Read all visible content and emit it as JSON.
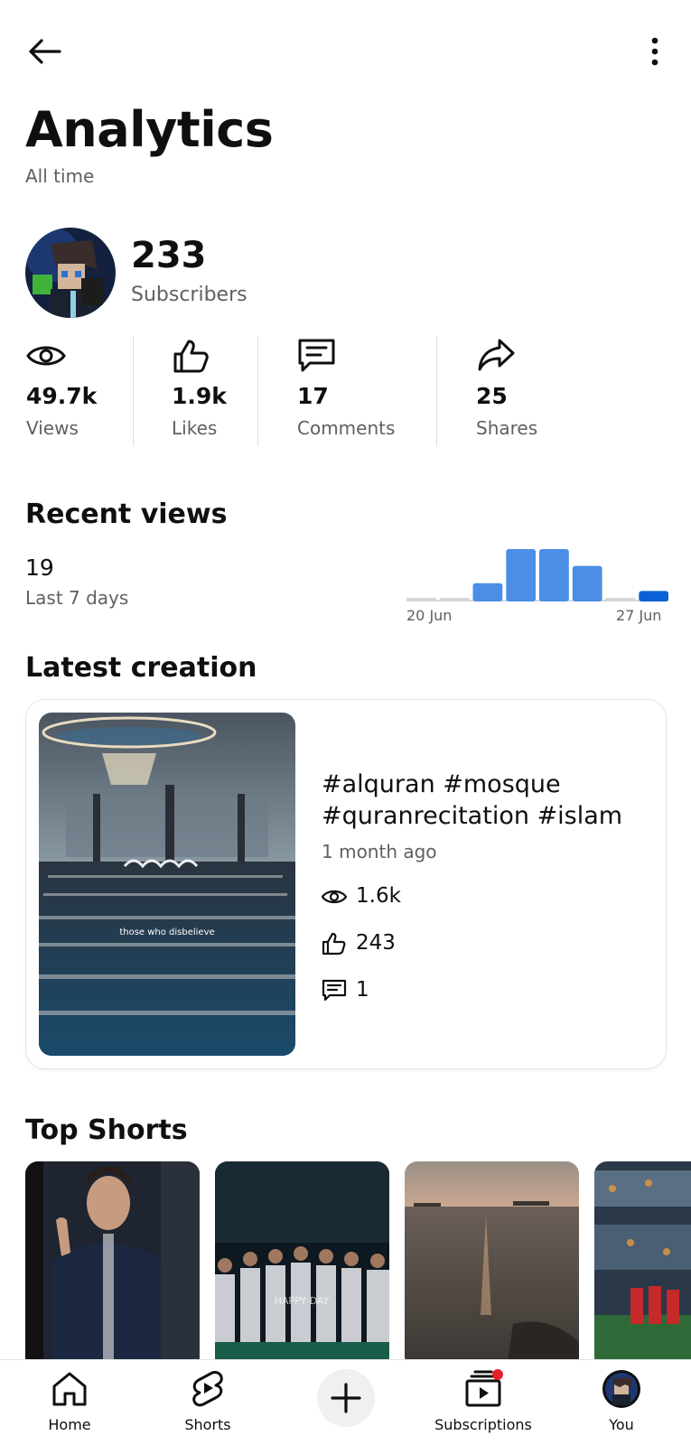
{
  "header": {
    "back_icon": "arrow-left-icon",
    "more_icon": "more-vertical-icon",
    "title": "Analytics",
    "subtitle": "All time"
  },
  "channel": {
    "subscribers": "233",
    "subscribers_label": "Subscribers"
  },
  "stats": [
    {
      "icon": "eye-icon",
      "value": "49.7k",
      "label": "Views"
    },
    {
      "icon": "thumbs-up-icon",
      "value": "1.9k",
      "label": "Likes"
    },
    {
      "icon": "comment-icon",
      "value": "17",
      "label": "Comments"
    },
    {
      "icon": "share-icon",
      "value": "25",
      "label": "Shares"
    }
  ],
  "recent_views": {
    "title": "Recent views",
    "count": "19",
    "period": "Last 7 days",
    "start_label": "20 Jun",
    "end_label": "27 Jun",
    "bars": [
      0,
      0,
      0.35,
      1.0,
      1.0,
      0.68,
      0,
      0.2
    ],
    "bar_color": "#4a8ee6",
    "last_bar_color": "#0b62d6"
  },
  "latest": {
    "title": "Latest creation",
    "video_title": "#alquran #mosque #quranrecitation #islam",
    "age": "1 month ago",
    "views": "1.6k",
    "likes": "243",
    "comments": "1",
    "thumb_caption": "those who disbelieve"
  },
  "top_shorts": {
    "title": "Top Shorts",
    "items": [
      {
        "thumb": "person-waving"
      },
      {
        "thumb": "football-team",
        "caption": "HAPPY DAY"
      },
      {
        "thumb": "sea-sunset"
      },
      {
        "thumb": "stadium-crowd"
      }
    ]
  },
  "nav": {
    "items": [
      {
        "label": "Home",
        "icon": "home-icon"
      },
      {
        "label": "Shorts",
        "icon": "shorts-icon"
      },
      {
        "label": "",
        "icon": "plus-icon"
      },
      {
        "label": "Subscriptions",
        "icon": "subscriptions-icon"
      },
      {
        "label": "You",
        "icon": "avatar-icon"
      }
    ],
    "notification_color": "#e5202a"
  }
}
